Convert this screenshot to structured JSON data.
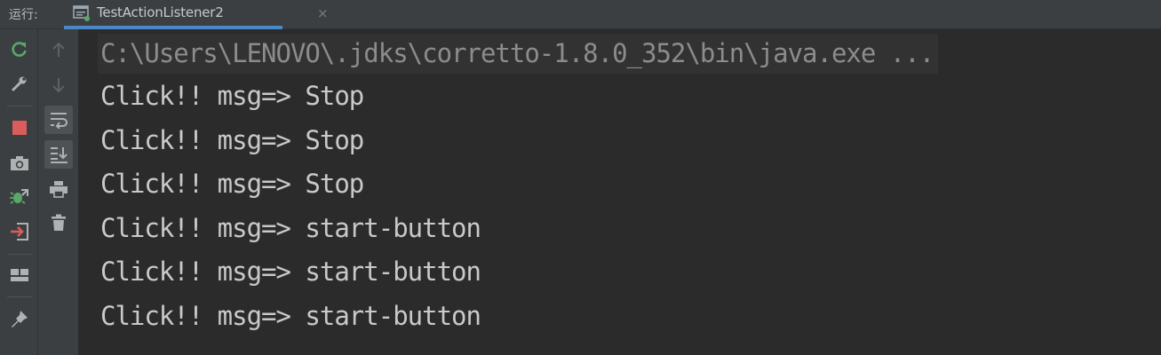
{
  "run_panel": {
    "label": "运行:",
    "tab": {
      "title": "TestActionListener2",
      "close_glyph": "×",
      "icon": "run-config-icon"
    }
  },
  "toolbar_primary": [
    {
      "name": "rerun-icon",
      "color": "#59a869"
    },
    {
      "name": "wrench-icon",
      "color": "#afb1b3"
    },
    {
      "name": "stop-icon",
      "color": "#db5c5c"
    },
    {
      "name": "camera-icon",
      "color": "#afb1b3"
    },
    {
      "name": "debug-threads-icon",
      "color": "#59a869"
    },
    {
      "name": "exit-icon",
      "color": "#db5c5c"
    },
    {
      "name": "layout-icon",
      "color": "#afb1b3"
    },
    {
      "name": "pin-icon",
      "color": "#afb1b3"
    }
  ],
  "toolbar_secondary": [
    {
      "name": "up-arrow-icon",
      "enabled": false
    },
    {
      "name": "down-arrow-icon",
      "enabled": false
    },
    {
      "name": "soft-wrap-icon",
      "active": true
    },
    {
      "name": "scroll-to-end-icon",
      "active": true
    },
    {
      "name": "print-icon"
    },
    {
      "name": "trash-icon"
    }
  ],
  "console": {
    "command": "C:\\Users\\LENOVO\\.jdks\\corretto-1.8.0_352\\bin\\java.exe ...",
    "lines": [
      "Click!! msg=> Stop",
      "Click!! msg=> Stop",
      "Click!! msg=> Stop",
      "Click!! msg=> start-button",
      "Click!! msg=> start-button",
      "Click!! msg=> start-button"
    ]
  },
  "colors": {
    "background": "#2b2b2b",
    "toolbar": "#3c3f41",
    "accent": "#4a88c7",
    "text": "#c9c9c9",
    "command_text": "#8c8c8c"
  }
}
